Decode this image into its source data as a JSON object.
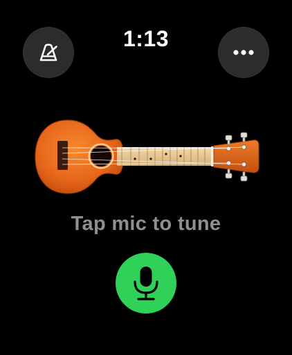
{
  "status_bar": {
    "time": "1:13"
  },
  "toolbar": {
    "left_icon": "metronome-icon",
    "right_icon": "ellipsis-icon"
  },
  "main": {
    "instrument_name": "ukulele",
    "prompt": "Tap mic to tune",
    "mic_icon": "microphone-icon"
  },
  "colors": {
    "background": "#000000",
    "button_background": "#2c2c2e",
    "prompt_text": "#8e8e93",
    "mic_accent": "#30d158",
    "ukulele_body": "#e8661a"
  }
}
